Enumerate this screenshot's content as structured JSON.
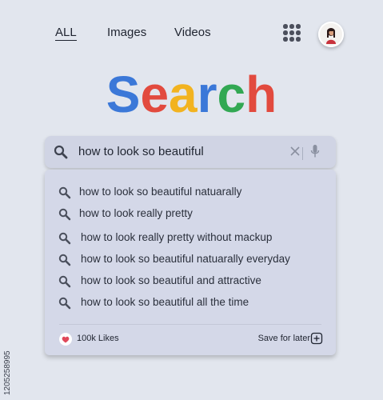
{
  "nav": {
    "tabs": [
      "ALL",
      "Images",
      "Videos"
    ],
    "apps_icon": "grid-dots-icon",
    "avatar": "user-avatar"
  },
  "logo": {
    "letters": [
      "S",
      "e",
      "a",
      "r",
      "c",
      "h"
    ],
    "colors": [
      "#3b78d8",
      "#e24a3e",
      "#f2b320",
      "#3b78d8",
      "#32a853",
      "#e24a3e"
    ]
  },
  "search": {
    "query": "how to look so beautiful",
    "search_icon": "search-icon",
    "clear_icon": "close-icon",
    "mic_icon": "microphone-icon"
  },
  "suggestions": [
    "how to look so beautiful  natuarally",
    "how to look really pretty",
    "how to look  really pretty without mackup",
    "how to look so beautiful  natuarally everyday",
    "how to look so beautiful and  attractive",
    "how to look so beautiful  all the time"
  ],
  "footer": {
    "likes": "100k Likes",
    "likes_icon": "heart-icon",
    "save": "Save for later",
    "save_icon": "plus-square-icon"
  },
  "watermark": "1205258995",
  "colors": {
    "background": "#e2e6ee",
    "panel": "#d4d8e8",
    "heart": "#e0485a"
  }
}
